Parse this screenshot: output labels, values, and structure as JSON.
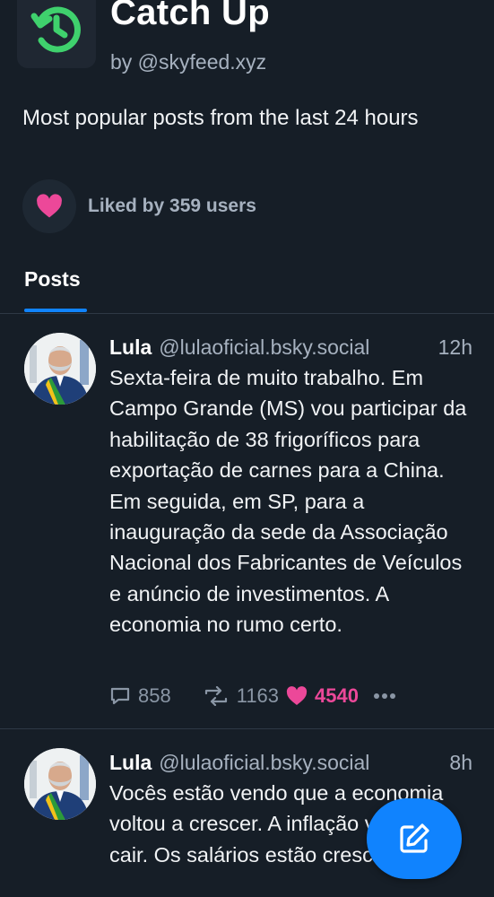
{
  "feed": {
    "title": "Catch Up",
    "byline": "by @skyfeed.xyz",
    "description": "Most popular posts from the last 24 hours",
    "liked_by": "Liked by 359 users",
    "icon": "clock-rewind-icon",
    "accent": "#3fd16d"
  },
  "tabs": [
    {
      "label": "Posts",
      "active": true
    }
  ],
  "posts": [
    {
      "name": "Lula",
      "handle": "@lulaoficial.bsky.social",
      "time": "12h",
      "text": "Sexta-feira de muito trabalho. Em Campo Grande (MS) vou participar da habilitação de 38 frigoríficos para exportação de carnes para a China. Em seguida, em SP, para a inauguração da sede da Associação Nacional dos Fabricantes de Veículos e anúncio de investimentos. A economia no rumo certo.",
      "replies": "858",
      "reposts": "1163",
      "likes": "4540",
      "liked": true
    },
    {
      "name": "Lula",
      "handle": "@lulaoficial.bsky.social",
      "time": "8h",
      "text": "Vocês estão vendo que a economia voltou a crescer. A inflação voltou a cair. Os salários estão crescendo. E"
    }
  ],
  "colors": {
    "background": "#161e27",
    "accent_blue": "#1083fe",
    "like_pink": "#ec4899",
    "muted": "#a6b1bf"
  },
  "compose_button": {
    "icon": "compose-icon"
  }
}
